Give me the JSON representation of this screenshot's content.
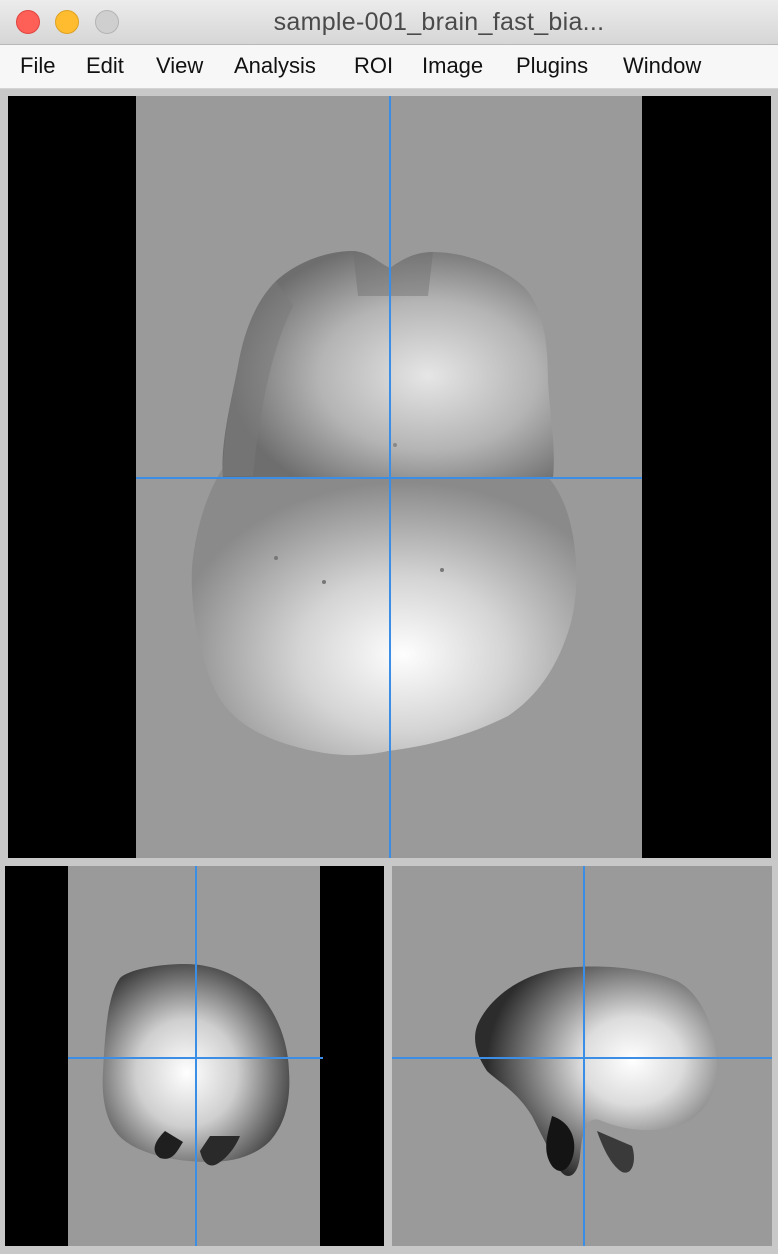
{
  "window": {
    "title": "sample-001_brain_fast_bia..."
  },
  "menu": {
    "file": "File",
    "edit": "Edit",
    "view": "View",
    "analysis": "Analysis",
    "roi": "ROI",
    "image": "Image",
    "plugins": "Plugins",
    "window": "Window"
  },
  "colors": {
    "crosshair": "#3a8ee6",
    "background": "#9a9a9a",
    "letterbox": "#000000"
  },
  "views": {
    "axial": "axial-view",
    "coronal": "coronal-view",
    "sagittal": "sagittal-view"
  }
}
